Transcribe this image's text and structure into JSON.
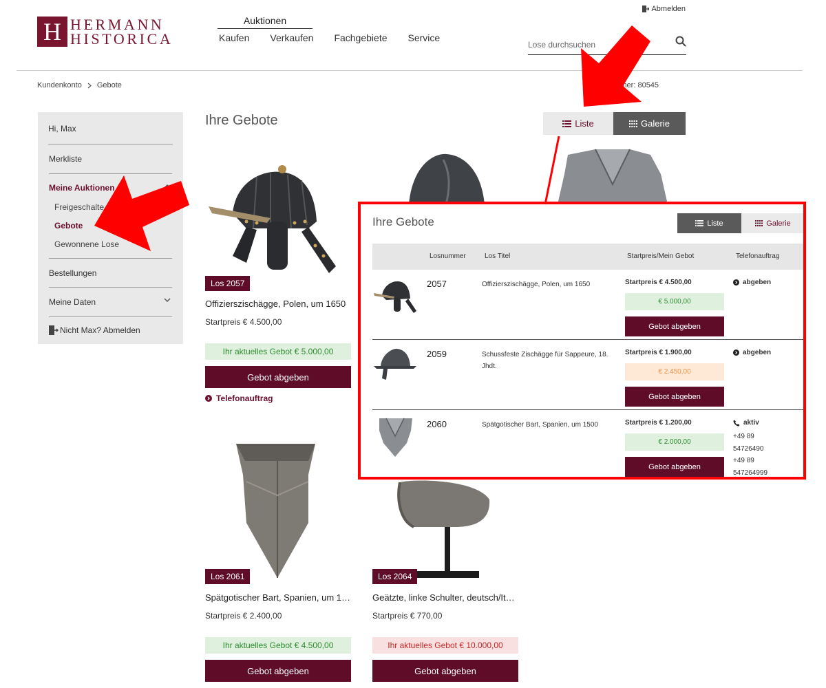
{
  "brand": {
    "line1": "HERMANN",
    "line2": "HISTORICA",
    "mark": "H"
  },
  "nav": {
    "auktionen": "Auktionen",
    "items": [
      "Kaufen",
      "Verkaufen",
      "Fachgebiete",
      "Service"
    ]
  },
  "header": {
    "logout": "Abmelden",
    "search_placeholder": "Lose durchsuchen",
    "bidder_number": "nummer: 80545"
  },
  "breadcrumb": [
    "Kundenkonto",
    "Gebote"
  ],
  "sidebar": {
    "greeting": "Hi, Max",
    "merkliste": "Merkliste",
    "meine_auktionen": "Meine Auktionen",
    "sub": [
      "Freigeschalte",
      "Gebote",
      "Gewonnene Lose"
    ],
    "bestellungen": "Bestellungen",
    "meine_daten": "Meine Daten",
    "logout": "Nicht Max? Abmelden"
  },
  "main": {
    "title": "Ihre Gebote",
    "view": {
      "liste": "Liste",
      "galerie": "Galerie"
    },
    "cards": [
      {
        "los": "Los 2057",
        "title": "Offizierszischägge, Polen, um 1650",
        "start": "Startpreis € 4.500,00",
        "current": "Ihr aktuelles Gebot € 5.000,00",
        "button": "Gebot abgeben",
        "tel": "Telefonauftrag"
      },
      {
        "los": "Los 2061",
        "title": "Spätgotischer Bart, Spanien, um 15...",
        "start": "Startpreis € 2.400,00",
        "current": "Ihr aktuelles Gebot € 4.500,00",
        "button": "Gebot abgeben"
      },
      {
        "los": "Los 2064",
        "title": "Geätzte, linke Schulter, deutsch/Ital...",
        "start": "Startpreis € 770,00",
        "current": "Ihr aktuelles Gebot € 10.000,00",
        "button": "Gebot abgeben"
      }
    ]
  },
  "panel": {
    "title": "Ihre Gebote",
    "view": {
      "liste": "Liste",
      "galerie": "Galerie"
    },
    "headers": {
      "losnummer": "Losnummer",
      "titel": "Los Titel",
      "preis": "Startpreis/Mein Gebot",
      "telefon": "Telefonauftrag"
    },
    "rows": [
      {
        "num": "2057",
        "title": "Offizierszischägge, Polen, um 1650",
        "start": "Startpreis € 4.500,00",
        "bid": "€ 5.000,00",
        "button": "Gebot abgeben",
        "tel": "abgeben"
      },
      {
        "num": "2059",
        "title": "Schussfeste Zischägge für Sappeure, 18. Jhdt.",
        "start": "Startpreis € 1.900,00",
        "bid": "€ 2.450,00",
        "button": "Gebot abgeben",
        "tel": "abgeben"
      },
      {
        "num": "2060",
        "title": "Spätgotischer Bart, Spanien, um 1500",
        "start": "Startpreis € 1.200,00",
        "bid": "€ 2.000,00",
        "button": "Gebot abgeben",
        "tel": "aktiv",
        "tel_lines": [
          "+49 89",
          "54726490",
          "+49 89",
          "547264999"
        ]
      }
    ]
  },
  "colors": {
    "brand": "#7a1530",
    "button": "#5e0c28",
    "annotation": "#ff0000"
  }
}
